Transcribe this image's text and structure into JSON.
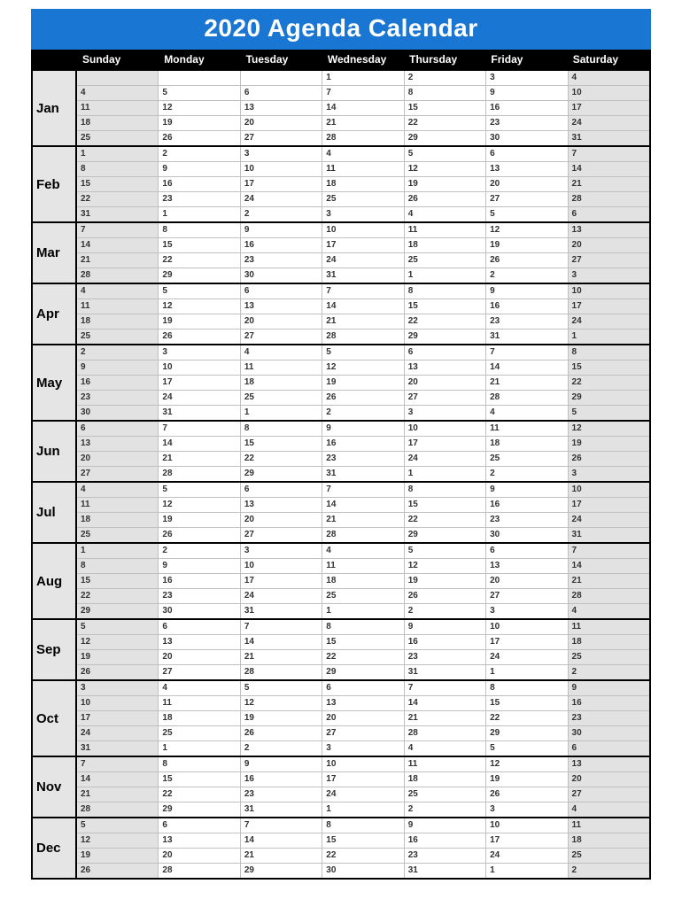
{
  "title": "2020 Agenda Calendar",
  "days": [
    "Sunday",
    "Monday",
    "Tuesday",
    "Wednesday",
    "Thursday",
    "Friday",
    "Saturday"
  ],
  "months": [
    {
      "label": "Jan",
      "weeks": [
        [
          "",
          "",
          "",
          "1",
          "2",
          "3",
          "4"
        ],
        [
          "4",
          "5",
          "6",
          "7",
          "8",
          "9",
          "10"
        ],
        [
          "11",
          "12",
          "13",
          "14",
          "15",
          "16",
          "17"
        ],
        [
          "18",
          "19",
          "20",
          "21",
          "22",
          "23",
          "24"
        ],
        [
          "25",
          "26",
          "27",
          "28",
          "29",
          "30",
          "31"
        ]
      ]
    },
    {
      "label": "Feb",
      "weeks": [
        [
          "1",
          "2",
          "3",
          "4",
          "5",
          "6",
          "7"
        ],
        [
          "8",
          "9",
          "10",
          "11",
          "12",
          "13",
          "14"
        ],
        [
          "15",
          "16",
          "17",
          "18",
          "19",
          "20",
          "21"
        ],
        [
          "22",
          "23",
          "24",
          "25",
          "26",
          "27",
          "28"
        ],
        [
          "31",
          "1",
          "2",
          "3",
          "4",
          "5",
          "6"
        ]
      ]
    },
    {
      "label": "Mar",
      "weeks": [
        [
          "7",
          "8",
          "9",
          "10",
          "11",
          "12",
          "13"
        ],
        [
          "14",
          "15",
          "16",
          "17",
          "18",
          "19",
          "20"
        ],
        [
          "21",
          "22",
          "23",
          "24",
          "25",
          "26",
          "27"
        ],
        [
          "28",
          "29",
          "30",
          "31",
          "1",
          "2",
          "3"
        ]
      ]
    },
    {
      "label": "Apr",
      "weeks": [
        [
          "4",
          "5",
          "6",
          "7",
          "8",
          "9",
          "10"
        ],
        [
          "11",
          "12",
          "13",
          "14",
          "15",
          "16",
          "17"
        ],
        [
          "18",
          "19",
          "20",
          "21",
          "22",
          "23",
          "24"
        ],
        [
          "25",
          "26",
          "27",
          "28",
          "29",
          "31",
          "1"
        ]
      ]
    },
    {
      "label": "May",
      "weeks": [
        [
          "2",
          "3",
          "4",
          "5",
          "6",
          "7",
          "8"
        ],
        [
          "9",
          "10",
          "11",
          "12",
          "13",
          "14",
          "15"
        ],
        [
          "16",
          "17",
          "18",
          "19",
          "20",
          "21",
          "22"
        ],
        [
          "23",
          "24",
          "25",
          "26",
          "27",
          "28",
          "29"
        ],
        [
          "30",
          "31",
          "1",
          "2",
          "3",
          "4",
          "5"
        ]
      ]
    },
    {
      "label": "Jun",
      "weeks": [
        [
          "6",
          "7",
          "8",
          "9",
          "10",
          "11",
          "12"
        ],
        [
          "13",
          "14",
          "15",
          "16",
          "17",
          "18",
          "19"
        ],
        [
          "20",
          "21",
          "22",
          "23",
          "24",
          "25",
          "26"
        ],
        [
          "27",
          "28",
          "29",
          "31",
          "1",
          "2",
          "3"
        ]
      ]
    },
    {
      "label": "Jul",
      "weeks": [
        [
          "4",
          "5",
          "6",
          "7",
          "8",
          "9",
          "10"
        ],
        [
          "11",
          "12",
          "13",
          "14",
          "15",
          "16",
          "17"
        ],
        [
          "18",
          "19",
          "20",
          "21",
          "22",
          "23",
          "24"
        ],
        [
          "25",
          "26",
          "27",
          "28",
          "29",
          "30",
          "31"
        ]
      ]
    },
    {
      "label": "Aug",
      "weeks": [
        [
          "1",
          "2",
          "3",
          "4",
          "5",
          "6",
          "7"
        ],
        [
          "8",
          "9",
          "10",
          "11",
          "12",
          "13",
          "14"
        ],
        [
          "15",
          "16",
          "17",
          "18",
          "19",
          "20",
          "21"
        ],
        [
          "22",
          "23",
          "24",
          "25",
          "26",
          "27",
          "28"
        ],
        [
          "29",
          "30",
          "31",
          "1",
          "2",
          "3",
          "4"
        ]
      ]
    },
    {
      "label": "Sep",
      "weeks": [
        [
          "5",
          "6",
          "7",
          "8",
          "9",
          "10",
          "11"
        ],
        [
          "12",
          "13",
          "14",
          "15",
          "16",
          "17",
          "18"
        ],
        [
          "19",
          "20",
          "21",
          "22",
          "23",
          "24",
          "25"
        ],
        [
          "26",
          "27",
          "28",
          "29",
          "31",
          "1",
          "2"
        ]
      ]
    },
    {
      "label": "Oct",
      "weeks": [
        [
          "3",
          "4",
          "5",
          "6",
          "7",
          "8",
          "9"
        ],
        [
          "10",
          "11",
          "12",
          "13",
          "14",
          "15",
          "16"
        ],
        [
          "17",
          "18",
          "19",
          "20",
          "21",
          "22",
          "23"
        ],
        [
          "24",
          "25",
          "26",
          "27",
          "28",
          "29",
          "30"
        ],
        [
          "31",
          "1",
          "2",
          "3",
          "4",
          "5",
          "6"
        ]
      ]
    },
    {
      "label": "Nov",
      "weeks": [
        [
          "7",
          "8",
          "9",
          "10",
          "11",
          "12",
          "13"
        ],
        [
          "14",
          "15",
          "16",
          "17",
          "18",
          "19",
          "20"
        ],
        [
          "21",
          "22",
          "23",
          "24",
          "25",
          "26",
          "27"
        ],
        [
          "28",
          "29",
          "31",
          "1",
          "2",
          "3",
          "4"
        ]
      ]
    },
    {
      "label": "Dec",
      "weeks": [
        [
          "5",
          "6",
          "7",
          "8",
          "9",
          "10",
          "11"
        ],
        [
          "12",
          "13",
          "14",
          "15",
          "16",
          "17",
          "18"
        ],
        [
          "19",
          "20",
          "21",
          "22",
          "23",
          "24",
          "25"
        ],
        [
          "26",
          "28",
          "29",
          "30",
          "31",
          "1",
          "2"
        ]
      ]
    }
  ]
}
